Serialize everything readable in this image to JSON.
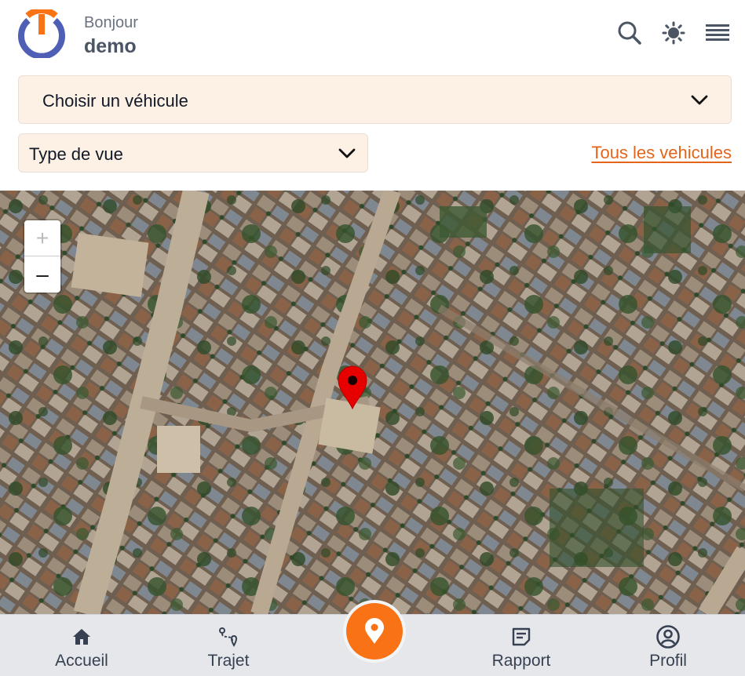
{
  "header": {
    "greeting": "Bonjour",
    "username": "demo",
    "icons": [
      "search-icon",
      "brightness-icon",
      "menu-icon"
    ]
  },
  "vehicle_select": {
    "placeholder": "Choisir un véhicule"
  },
  "view_select": {
    "placeholder": "Type de vue"
  },
  "all_vehicles_link": "Tous les vehicules",
  "map": {
    "zoom_in": "+",
    "zoom_out": "–"
  },
  "nav": {
    "items": [
      {
        "label": "Accueil",
        "icon": "home-icon"
      },
      {
        "label": "Trajet",
        "icon": "route-icon"
      },
      {
        "label": "Rapport",
        "icon": "report-icon"
      },
      {
        "label": "Profil",
        "icon": "profile-icon"
      }
    ],
    "center_icon": "location-pin-icon"
  },
  "colors": {
    "accent": "#f97316",
    "link": "#e4651a",
    "logo_blue": "#4f5fb5",
    "select_bg": "#fdf1e6",
    "marker": "#e60000"
  }
}
